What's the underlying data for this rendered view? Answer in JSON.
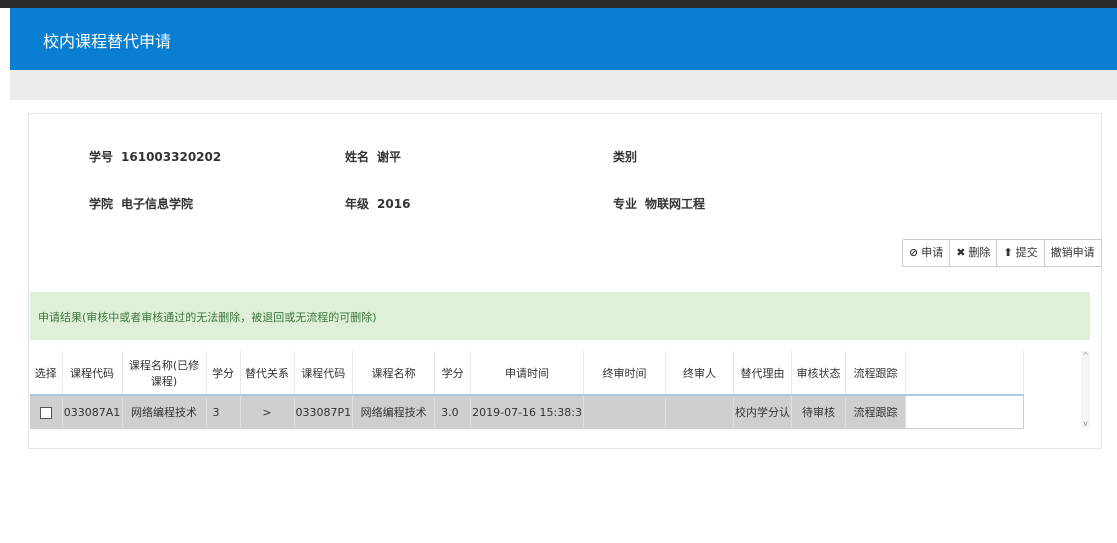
{
  "header": {
    "title": "校内课程替代申请"
  },
  "student": {
    "id_label": "学号",
    "id_value": "161003320202",
    "name_label": "姓名",
    "name_value": "谢平",
    "category_label": "类别",
    "category_value": "",
    "college_label": "学院",
    "college_value": "电子信息学院",
    "grade_label": "年级",
    "grade_value": "2016",
    "major_label": "专业",
    "major_value": "物联网工程"
  },
  "toolbar": {
    "apply": "申请",
    "apply_icon": "⊘",
    "delete": "删除",
    "delete_icon": "✖",
    "submit": "提交",
    "submit_icon": "⬆",
    "revoke": "撤销申请"
  },
  "result_note": "申请结果(审核中或者审核通过的无法删除，被退回或无流程的可删除)",
  "table": {
    "headers": [
      "选择",
      "课程代码",
      "课程名称(已修课程)",
      "学分",
      "替代关系",
      "课程代码",
      "课程名称",
      "学分",
      "申请时间",
      "终审时间",
      "终审人",
      "替代理由",
      "审核状态",
      "流程跟踪"
    ],
    "rows": [
      [
        "",
        "033087A1",
        "网络编程技术",
        "3",
        ">",
        "033087P1",
        "网络编程技术",
        "3.0",
        "2019-07-16 15:38:3",
        "",
        "",
        "校内学分认",
        "待审核",
        "流程跟踪"
      ]
    ]
  },
  "colors": {
    "header_bg": "#0a7fd1",
    "success_bg": "#dff0d8",
    "link": "#1e6fc8"
  }
}
